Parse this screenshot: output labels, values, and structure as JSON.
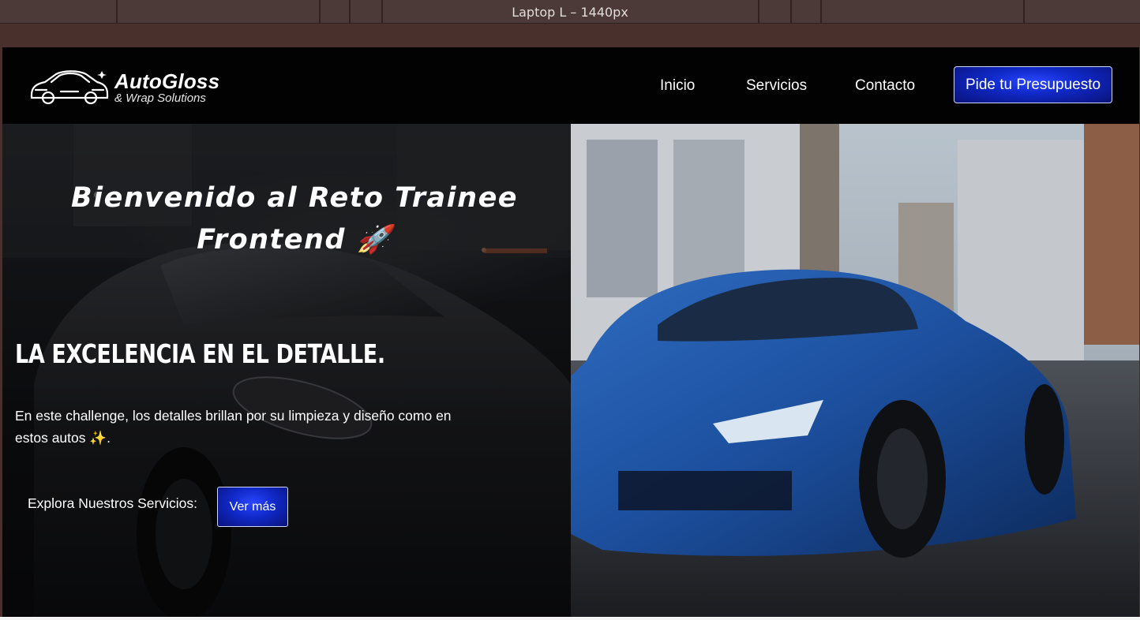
{
  "devtools": {
    "ruler_label": "Laptop L – 1440px"
  },
  "header": {
    "brand_name": "AutoGloss",
    "brand_sub": "& Wrap Solutions",
    "nav": [
      "Inicio",
      "Servicios",
      "Contacto"
    ],
    "cta_label": "Pide tu Presupuesto"
  },
  "hero": {
    "title_line1": "Bienvenido al Reto Trainee",
    "title_line2": "Frontend 🚀",
    "tagline": "LA EXCELENCIA EN EL DETALLE.",
    "description": "En este challenge, los detalles brillan por su limpieza y diseño como en estos autos ✨.",
    "explore_label": "Explora Nuestros Servicios:",
    "button_label": "Ver más"
  },
  "colors": {
    "accent": "#1029c8",
    "background": "#020203",
    "text": "#ffffff"
  },
  "icons": [
    "car-logo-icon"
  ]
}
